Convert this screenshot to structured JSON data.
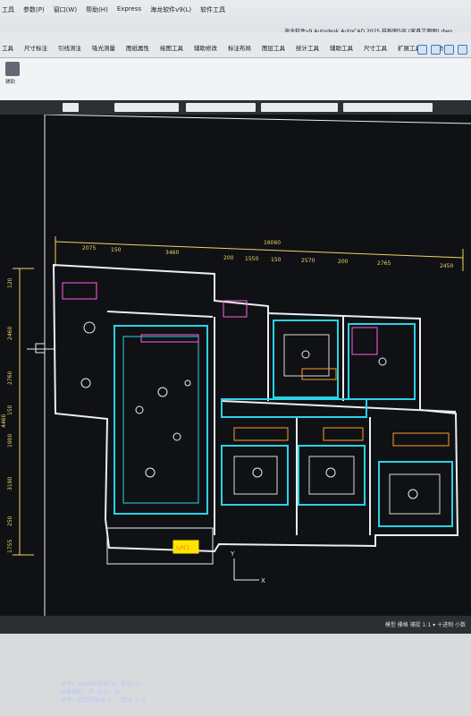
{
  "app": {
    "menu": [
      "工具",
      "参数(P)",
      "窗口(W)",
      "帮助(H)",
      "Express",
      "海龙软件v9(L)",
      "软件工具"
    ],
    "window_title": "海龙软件v9 Autodesk AutoCAD 2025 样板图5层 (家具立面图).dwg"
  },
  "ribbon": {
    "tabs": [
      "工具",
      "尺寸标注",
      "引线测注",
      "吸光测量",
      "图纸属性",
      "绘图工具",
      "辅助修改",
      "标注布局",
      "图层工具",
      "统计工具",
      "辅助工具",
      "尺寸工具",
      "扩展工具",
      "帮助"
    ],
    "panel_label": "辅助"
  },
  "drawing": {
    "dimensions_top": [
      "2075",
      "150",
      "3460",
      "16060",
      "200",
      "1550",
      "150",
      "2570",
      "200",
      "2765",
      "2450"
    ],
    "dimensions_left": [
      "120",
      "2460",
      "2760",
      "150",
      "4460",
      "1900",
      "3190",
      "250",
      "1755"
    ],
    "room_tag": "入户门"
  },
  "command_line": {
    "lines": [
      "命令: LAYOUT选项(V) 布局(L)",
      "对象捕捉: 开 正交: 关",
      "命令: 指定对角点 1 : 找到 1 个"
    ]
  },
  "statusbar": {
    "text": "模型 栅格 捕捉 1:1 ▾ 十进制 小数"
  }
}
